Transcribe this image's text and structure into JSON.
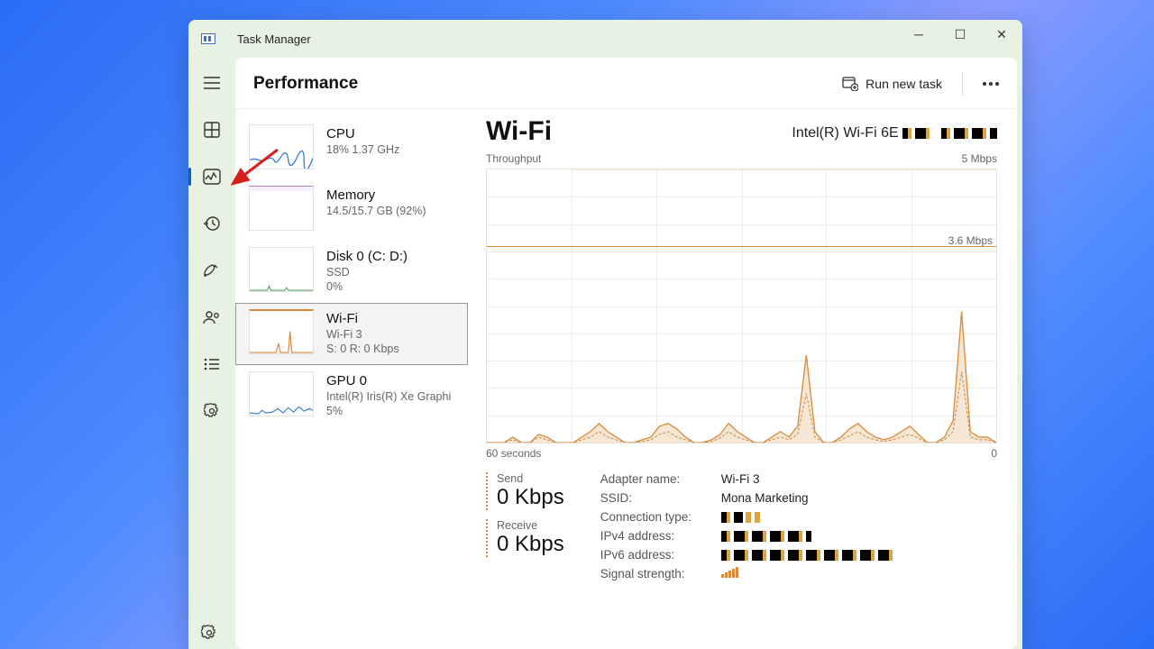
{
  "app": {
    "title": "Task Manager"
  },
  "header": {
    "page": "Performance",
    "run_new_task": "Run new task"
  },
  "resources": [
    {
      "name": "CPU",
      "sub1": "18%  1.37 GHz",
      "sub2": ""
    },
    {
      "name": "Memory",
      "sub1": "14.5/15.7 GB (92%)",
      "sub2": ""
    },
    {
      "name": "Disk 0 (C: D:)",
      "sub1": "SSD",
      "sub2": "0%"
    },
    {
      "name": "Wi-Fi",
      "sub1": "Wi-Fi 3",
      "sub2": "S: 0 R: 0 Kbps"
    },
    {
      "name": "GPU 0",
      "sub1": "Intel(R) Iris(R) Xe Graphi",
      "sub2": "5%"
    }
  ],
  "wifi": {
    "title": "Wi-Fi",
    "adapter": "Intel(R) Wi-Fi 6E",
    "throughput_label": "Throughput",
    "y_max": "5 Mbps",
    "guide": "3.6 Mbps",
    "x_left": "60 seconds",
    "x_right": "0",
    "send_label": "Send",
    "send_value": "0 Kbps",
    "recv_label": "Receive",
    "recv_value": "0 Kbps",
    "info": {
      "adapter_name_l": "Adapter name:",
      "adapter_name_v": "Wi-Fi 3",
      "ssid_l": "SSID:",
      "ssid_v": "Mona Marketing",
      "conn_l": "Connection type:",
      "conn_v": "",
      "ipv4_l": "IPv4 address:",
      "ipv4_v": "",
      "ipv6_l": "IPv6 address:",
      "ipv6_v": "",
      "signal_l": "Signal strength:"
    }
  },
  "chart_data": {
    "type": "line",
    "title": "Wi-Fi Throughput",
    "xlabel": "seconds ago",
    "ylabel": "Mbps",
    "xlim": [
      60,
      0
    ],
    "ylim": [
      0,
      5
    ],
    "series": [
      {
        "name": "Send",
        "values": [
          0,
          0,
          0,
          0.1,
          0,
          0,
          0.15,
          0.1,
          0,
          0,
          0,
          0.1,
          0.2,
          0.35,
          0.2,
          0.1,
          0,
          0,
          0.05,
          0.1,
          0.3,
          0.35,
          0.25,
          0.1,
          0,
          0,
          0.05,
          0.15,
          0.35,
          0.2,
          0.1,
          0,
          0,
          0.1,
          0.2,
          0.1,
          0.3,
          1.6,
          0.2,
          0,
          0,
          0.1,
          0.25,
          0.35,
          0.2,
          0.1,
          0.05,
          0.1,
          0.2,
          0.3,
          0.15,
          0,
          0,
          0.1,
          0.4,
          2.4,
          0.2,
          0.1,
          0.1,
          0
        ]
      },
      {
        "name": "Receive",
        "values": [
          0,
          0,
          0,
          0.05,
          0,
          0,
          0.1,
          0.05,
          0,
          0,
          0,
          0.05,
          0.1,
          0.2,
          0.1,
          0.05,
          0,
          0,
          0.02,
          0.05,
          0.15,
          0.2,
          0.1,
          0.05,
          0,
          0,
          0.02,
          0.08,
          0.2,
          0.1,
          0.05,
          0,
          0,
          0.05,
          0.1,
          0.05,
          0.15,
          0.9,
          0.1,
          0,
          0,
          0.05,
          0.12,
          0.2,
          0.1,
          0.05,
          0.02,
          0.05,
          0.1,
          0.15,
          0.08,
          0,
          0,
          0.05,
          0.2,
          1.3,
          0.1,
          0.05,
          0.05,
          0
        ]
      }
    ]
  }
}
